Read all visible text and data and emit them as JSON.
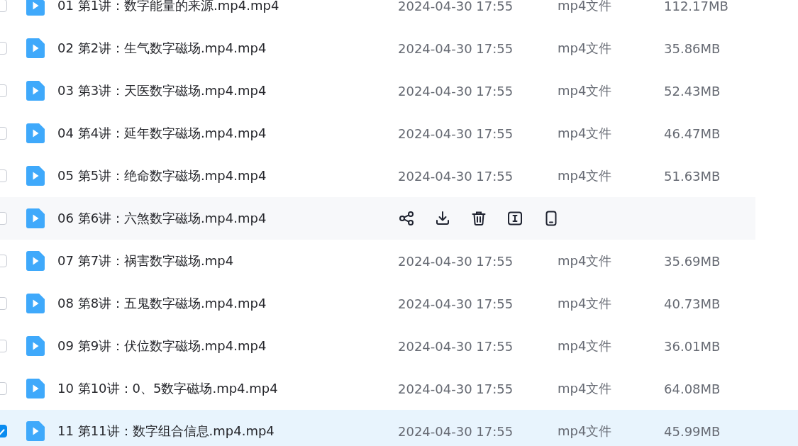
{
  "files": [
    {
      "name": "01 第1讲：数字能量的来源.mp4.mp4",
      "date": "2024-04-30 17:55",
      "type": "mp4文件",
      "size": "112.17MB",
      "selected": false,
      "hovered": false
    },
    {
      "name": "02 第2讲：生气数字磁场.mp4.mp4",
      "date": "2024-04-30 17:55",
      "type": "mp4文件",
      "size": "35.86MB",
      "selected": false,
      "hovered": false
    },
    {
      "name": "03 第3讲：天医数字磁场.mp4.mp4",
      "date": "2024-04-30 17:55",
      "type": "mp4文件",
      "size": "52.43MB",
      "selected": false,
      "hovered": false
    },
    {
      "name": "04 第4讲：延年数字磁场.mp4.mp4",
      "date": "2024-04-30 17:55",
      "type": "mp4文件",
      "size": "46.47MB",
      "selected": false,
      "hovered": false
    },
    {
      "name": "05 第5讲：绝命数字磁场.mp4.mp4",
      "date": "2024-04-30 17:55",
      "type": "mp4文件",
      "size": "51.63MB",
      "selected": false,
      "hovered": false
    },
    {
      "name": "06 第6讲：六煞数字磁场.mp4.mp4",
      "selected": false,
      "hovered": true,
      "actions": [
        {
          "kind": "share"
        },
        {
          "kind": "download"
        },
        {
          "kind": "delete"
        },
        {
          "kind": "rename"
        },
        {
          "kind": "phone"
        }
      ]
    },
    {
      "name": "07 第7讲：祸害数字磁场.mp4",
      "date": "2024-04-30 17:55",
      "type": "mp4文件",
      "size": "35.69MB",
      "selected": false,
      "hovered": false
    },
    {
      "name": "08 第8讲：五鬼数字磁场.mp4.mp4",
      "date": "2024-04-30 17:55",
      "type": "mp4文件",
      "size": "40.73MB",
      "selected": false,
      "hovered": false
    },
    {
      "name": "09 第9讲：伏位数字磁场.mp4.mp4",
      "date": "2024-04-30 17:55",
      "type": "mp4文件",
      "size": "36.01MB",
      "selected": false,
      "hovered": false
    },
    {
      "name": "10 第10讲：0、5数字磁场.mp4.mp4",
      "date": "2024-04-30 17:55",
      "type": "mp4文件",
      "size": "64.08MB",
      "selected": false,
      "hovered": false
    },
    {
      "name": "11 第11讲：数字组合信息.mp4.mp4",
      "date": "2024-04-30 17:55",
      "type": "mp4文件",
      "size": "45.99MB",
      "selected": true,
      "hovered": false
    }
  ]
}
